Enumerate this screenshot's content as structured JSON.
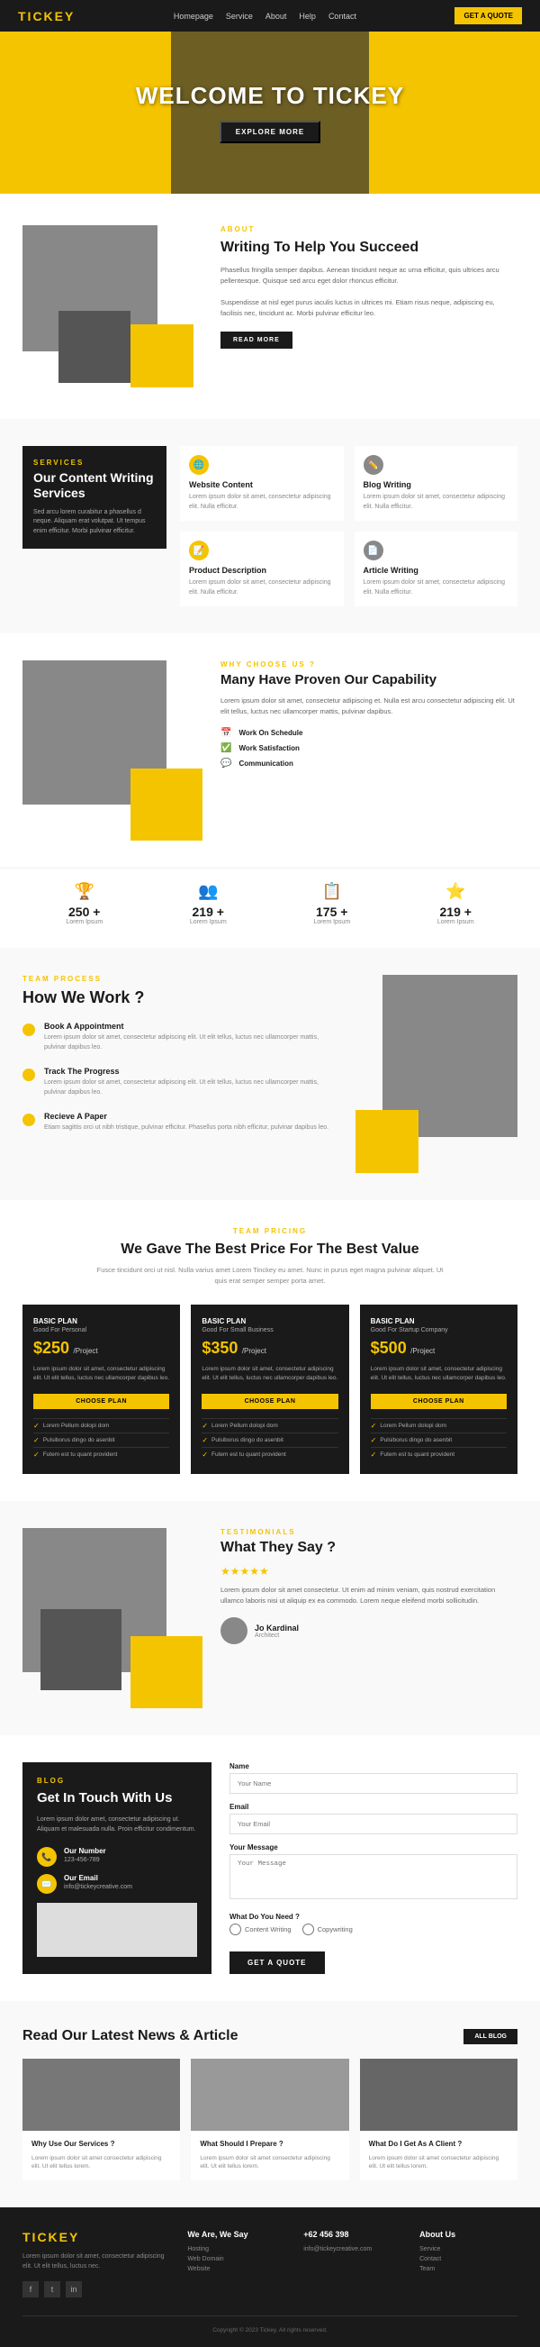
{
  "nav": {
    "logo": "TICKEY",
    "links": [
      "Homepage",
      "Service",
      "About",
      "Help",
      "Contact"
    ],
    "cta": "GET A QUOTE"
  },
  "hero": {
    "title": "WELCOME TO TICKEY",
    "explore_btn": "EXPLORE MORE"
  },
  "about": {
    "label": "ABOUT",
    "title": "Writing To Help You Succeed",
    "text1": "Phasellus fringilla semper dapibus. Aenean tincidunt neque ac urna efficitur, quis ultrices arcu pellentesque. Quisque sed arcu eget dolor rhoncus efficitur.",
    "text2": "Suspendisse at nisl eget purus iaculis luctus in ultrices mi. Etiam risus neque, adipiscing eu, facilisis nec, tincidunt ac. Morbi pulvinar efficitur leo.",
    "read_more": "READ MORE"
  },
  "services": {
    "label": "SERVICES",
    "title": "Our Content Writing Services",
    "desc": "Sed arcu lorem curabitur a phasellus d neque. Aliquam erat volutpat. Ut tempus enim efficitur. Morbi pulvinar efficitur.",
    "items": [
      {
        "icon": "🌐",
        "icon_color": "yellow",
        "name": "Website Content",
        "desc": "Lorem ipsum dolor sit amet, consectetur adipiscing elit. Nulla efficitur."
      },
      {
        "icon": "✏️",
        "icon_color": "gray",
        "name": "Blog Writing",
        "desc": "Lorem ipsum dolor sit amet, consectetur adipiscing elit. Nulla efficitur."
      },
      {
        "icon": "📝",
        "icon_color": "yellow",
        "name": "Product Description",
        "desc": "Lorem ipsum dolor sit amet, consectetur adipiscing elit. Nulla efficitur."
      },
      {
        "icon": "📄",
        "icon_color": "gray",
        "name": "Article Writing",
        "desc": "Lorem ipsum dolor sit amet, consectetur adipiscing elit. Nulla efficitur."
      }
    ]
  },
  "capability": {
    "label": "WHY CHOOSE US ?",
    "title": "Many Have Proven Our Capability",
    "desc": "Lorem ipsum dolor sit amet, consectetur adipiscing et. Nulla est arcu consectetur adipiscing elit. Ut elit tellus, luctus nec ullamcorper mattis, pulvinar dapibus.",
    "features": [
      "Work On Schedule",
      "Work Satisfaction",
      "Communication"
    ]
  },
  "stats": [
    {
      "icon": "🏆",
      "number": "250 +",
      "label": "Lorem Ipsum"
    },
    {
      "icon": "👥",
      "number": "219 +",
      "label": "Lorem Ipsum"
    },
    {
      "icon": "📋",
      "number": "175 +",
      "label": "Lorem Ipsum"
    },
    {
      "icon": "⭐",
      "number": "219 +",
      "label": "Lorem Ipsum"
    }
  ],
  "howwork": {
    "label": "TEAM PROCESS",
    "title": "How We Work ?",
    "steps": [
      {
        "title": "Book A Appointment",
        "desc": "Lorem ipsum dolor sit amet, consectetur adipiscing elit. Ut elit tellus, luctus nec ullamcorper mattis, pulvinar dapibus leo."
      },
      {
        "title": "Track The Progress",
        "desc": "Lorem ipsum dolor sit amet, consectetur adipiscing elit. Ut elit tellus, luctus nec ullamcorper mattis, pulvinar dapibus leo."
      },
      {
        "title": "Recieve A Paper",
        "desc": "Etiam sagittis orci ut nibh tristique, pulvinar efficitur. Phasellus porta nibh efficitur, pulvinar dapibus leo."
      }
    ]
  },
  "pricing": {
    "label": "TEAM PRICING",
    "title": "We Gave The Best Price For The Best Value",
    "desc": "Fusce tincidunt orci ut nisl. Nulla varius amet Lorem Tinckey eu amet. Nunc in purus eget magna pulvinar aliquet. Ut quis erat semper semper porta amet.",
    "plans": [
      {
        "name": "Basic Plan",
        "type": "Good For Personal",
        "amount": "$250",
        "period": "/Project",
        "desc": "Lorem ipsum dolor sit amet, consectetur adipiscing elit. Ut elit tellus, luctus nec ullamcorper dapibus leo.",
        "btn": "CHOOSE PLAN",
        "features": [
          "Lorem Pellum dolopi dom",
          "Pulsiborus dingo do asenbit",
          "Futem est tu quant provident"
        ]
      },
      {
        "name": "Basic Plan",
        "type": "Good For Small Business",
        "amount": "$350",
        "period": "/Project",
        "desc": "Lorem ipsum dolor sit amet, consectetur adipiscing elit. Ut elit tellus, luctus nec ullamcorper dapibus leo.",
        "btn": "CHOOSE PLAN",
        "features": [
          "Lorem Pellum dolopi dom",
          "Pulsiborus dingo do asenbit",
          "Futem est tu quant provident"
        ]
      },
      {
        "name": "Basic Plan",
        "type": "Good For Startup Company",
        "amount": "$500",
        "period": "/Project",
        "desc": "Lorem ipsum dolor sit amet, consectetur adipiscing elit. Ut elit tellus, luctus nec ullamcorper dapibus leo.",
        "btn": "CHOOSE PLAN",
        "features": [
          "Lorem Pellum dolopi dom",
          "Pulsiborus dingo do asenbit",
          "Futem est tu quant provident"
        ]
      }
    ]
  },
  "testimonials": {
    "label": "TESTIMONIALS",
    "title": "What They Say ?",
    "stars": "★★★★★",
    "text": "Lorem ipsum dolor sit amet consectetur. Ut enim ad minim veniam, quis nostrud exercitation ullamco laboris nisi ut aliquip ex ea commodo. Lorem neque eleifend morbi sollicitudin.",
    "person": {
      "name": "Jo Kardinal",
      "role": "Architect"
    }
  },
  "contact": {
    "label": "BLOG",
    "title": "Get In Touch With Us",
    "desc": "Lorem ipsum dolor amet, consectetur adipiscing ut. Aliquam et malesuada nulla. Proin efficitur condimentum.",
    "info": [
      {
        "icon": "📞",
        "label": "Our Number",
        "value": "123-456-789"
      },
      {
        "icon": "✉️",
        "label": "Our Email",
        "value": "info@tickeycreative.com"
      }
    ],
    "form": {
      "name_label": "Name",
      "name_placeholder": "Your Name",
      "email_label": "Email",
      "email_placeholder": "Your Email",
      "message_label": "Your Message",
      "message_placeholder": "Your Message",
      "need_label": "What Do You Need ?",
      "options": [
        "Content Writing",
        "Copywriting"
      ],
      "submit": "GET A QUOTE"
    }
  },
  "blog": {
    "title": "Read Our Latest News & Article",
    "all_btn": "ALL BLOG",
    "posts": [
      {
        "title": "Why Use Our Services ?",
        "desc": "Lorem ipsum dolor sit amet consectetur adipiscing elit. Ut elit tellus lorem."
      },
      {
        "title": "What Should I Prepare ?",
        "desc": "Lorem ipsum dolor sit amet consectetur adipiscing elit. Ut elit tellus lorem."
      },
      {
        "title": "What Do I Get As A Client ?",
        "desc": "Lorem ipsum dolor sit amet consectetur adipiscing elit. Ut elit tellus lorem."
      }
    ]
  },
  "footer": {
    "logo": "TICKEY",
    "desc": "Lorem ipsum dolor sit amet, consectetur adipiscing elit. Ut elit tellus, luctus nec.",
    "cols": [
      {
        "title": "We Are, We Say",
        "items": [
          "Hosting",
          "Web Domain",
          "Website"
        ]
      },
      {
        "title": "+62 456 398",
        "items": [
          "info@tickeycreative.com"
        ]
      },
      {
        "title": "About Us",
        "items": [
          "Service",
          "Contact",
          "Team"
        ]
      }
    ],
    "copyright": "Copyright © 2023 Tickey. All rights reserved."
  }
}
